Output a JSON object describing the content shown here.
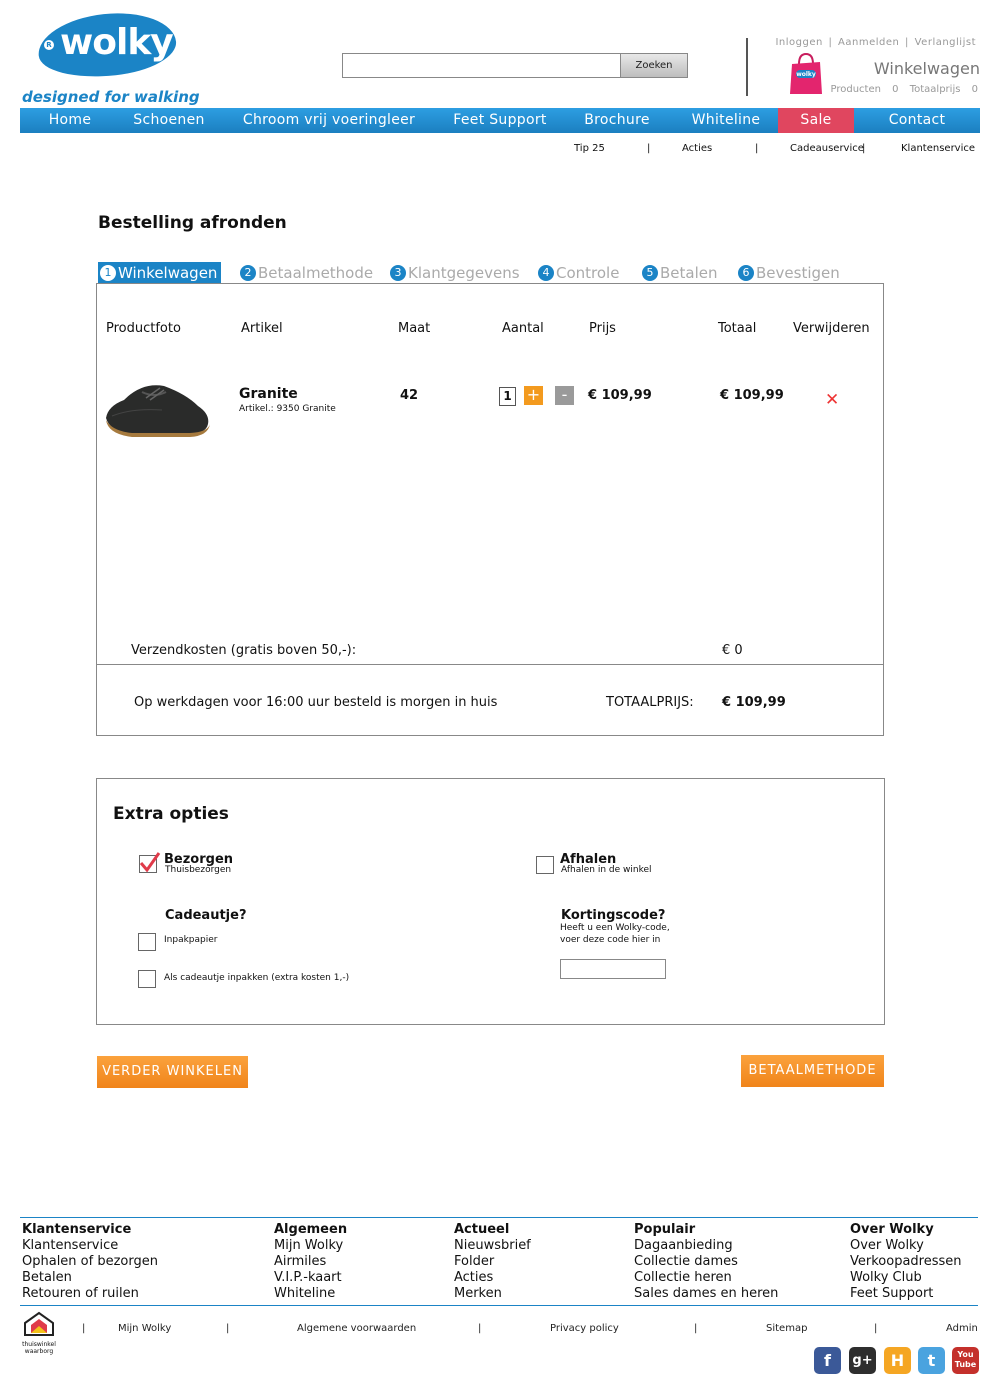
{
  "brand": {
    "name": "wolky",
    "registered": "R",
    "tagline": "designed for walking"
  },
  "search": {
    "placeholder": "",
    "button": "Zoeken"
  },
  "toplinks": [
    "Inloggen",
    "Aanmelden",
    "Verlanglijst"
  ],
  "cart": {
    "title": "Winkelwagen",
    "products_label": "Producten",
    "products_count": "0",
    "total_label": "Totaalprijs",
    "total_value": "0",
    "bag_text": "wolky"
  },
  "nav": [
    "Home",
    "Schoenen",
    "Chroom vrij voeringleer",
    "Feet Support",
    "Brochure",
    "Whiteline",
    "Sale",
    "Contact"
  ],
  "subnav": [
    "Tip 25",
    "Acties",
    "Cadeauservice",
    "Klantenservice"
  ],
  "page_title": "Bestelling afronden",
  "steps": [
    {
      "num": "1",
      "label": "Winkelwagen"
    },
    {
      "num": "2",
      "label": "Betaalmethode"
    },
    {
      "num": "3",
      "label": "Klantgegevens"
    },
    {
      "num": "4",
      "label": "Controle"
    },
    {
      "num": "5",
      "label": "Betalen"
    },
    {
      "num": "6",
      "label": "Bevestigen"
    }
  ],
  "table_headers": [
    "Productfoto",
    "Artikel",
    "Maat",
    "Aantal",
    "Prijs",
    "Totaal",
    "Verwijderen"
  ],
  "item": {
    "name": "Granite",
    "article": "Artikel.: 9350 Granite",
    "size": "42",
    "qty": "1",
    "plus": "+",
    "minus": "-",
    "price": "€ 109,99",
    "total": "€ 109,99",
    "remove": "✕"
  },
  "shipping": {
    "label": "Verzendkosten  (gratis boven 50,-):",
    "value": "€ 0"
  },
  "delivery_note": "Op werkdagen voor 16:00 uur besteld is morgen in huis",
  "totaalprijs": {
    "label": "TOTAALPRIJS:",
    "value": "€ 109,99"
  },
  "extra": {
    "title": "Extra opties",
    "bezorgen": {
      "label": "Bezorgen",
      "sub": "Thuisbezorgen",
      "checked": true
    },
    "afhalen": {
      "label": "Afhalen",
      "sub": "Afhalen in de winkel",
      "checked": false
    },
    "cadeau": {
      "title": "Cadeautje?",
      "opt1": "Inpakpapier",
      "opt2": "Als cadeautje inpakken (extra kosten 1,-)"
    },
    "korting": {
      "title": "Kortingscode?",
      "line1": "Heeft u een Wolky-code,",
      "line2": "voer deze code hier in",
      "value": ""
    }
  },
  "buttons": {
    "continue": "VERDER WINKELEN",
    "next": "BETAALMETHODE"
  },
  "footer": {
    "columns": [
      {
        "heading": "Klantenservice",
        "links": [
          "Klantenservice",
          "Ophalen of bezorgen",
          "Betalen",
          "Retouren of ruilen"
        ]
      },
      {
        "heading": "Algemeen",
        "links": [
          "Mijn Wolky",
          "Airmiles",
          "V.I.P.-kaart",
          "Whiteline"
        ]
      },
      {
        "heading": "Actueel",
        "links": [
          "Nieuwsbrief",
          "Folder",
          "Acties",
          "Merken"
        ]
      },
      {
        "heading": "Populair",
        "links": [
          "Dagaanbieding",
          "Collectie dames",
          "Collectie heren",
          "Sales dames en heren"
        ]
      },
      {
        "heading": "Over Wolky",
        "links": [
          "Over Wolky",
          "Verkoopadressen",
          "Wolky Club",
          "Feet Support"
        ]
      }
    ],
    "badge": [
      "thuiswinkel",
      "waarborg"
    ],
    "bottom_links": [
      "Mijn Wolky",
      "Algemene voorwaarden",
      "Privacy policy",
      "Sitemap",
      "Admin"
    ],
    "social": [
      {
        "icon": "facebook-icon",
        "glyph": "f",
        "color": "#3b5998"
      },
      {
        "icon": "google-plus-icon",
        "glyph": "g+",
        "color": "#2e2e2e"
      },
      {
        "icon": "hyves-icon",
        "glyph": "H",
        "color": "#f5a623"
      },
      {
        "icon": "twitter-icon",
        "glyph": "t",
        "color": "#4aa3df"
      },
      {
        "icon": "youtube-icon",
        "glyph": "You Tube",
        "color": "#c4302b"
      }
    ]
  }
}
